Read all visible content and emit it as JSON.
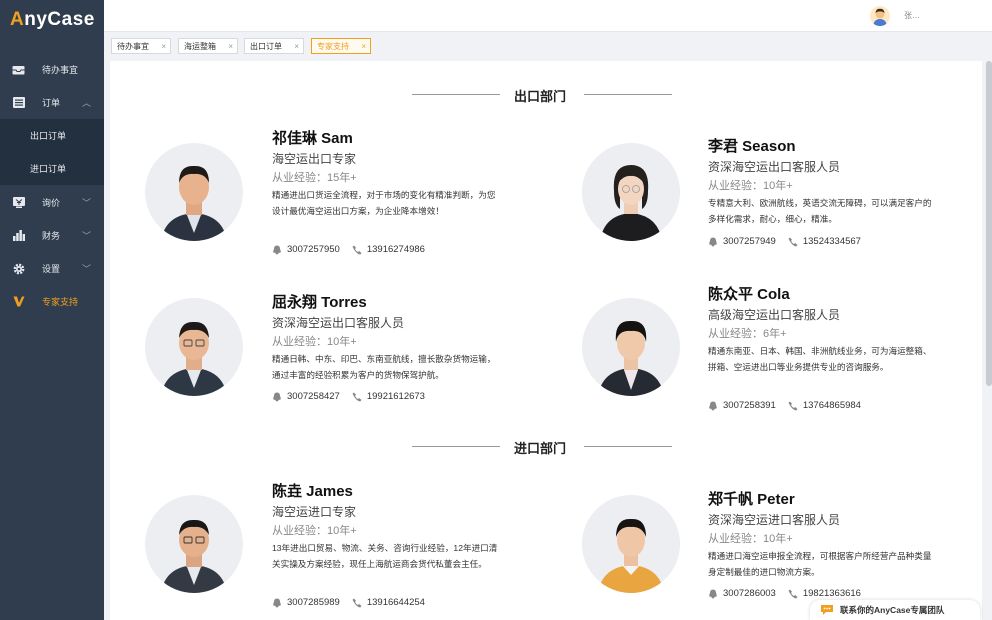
{
  "app": {
    "logo_a": "A",
    "logo_rest": "nyCase"
  },
  "sidebar": {
    "items": [
      {
        "label": "待办事宜",
        "icon": "inbox-icon"
      },
      {
        "label": "订单",
        "icon": "list-icon"
      },
      {
        "label": "出口订单"
      },
      {
        "label": "进口订单"
      },
      {
        "label": "询价",
        "icon": "quote-icon"
      },
      {
        "label": "财务",
        "icon": "chart-icon"
      },
      {
        "label": "设置",
        "icon": "gear-icon"
      },
      {
        "label": "专家支持",
        "icon": "v-icon"
      }
    ],
    "accent": "#f0a020"
  },
  "header": {
    "user_name": "张…"
  },
  "tabs": [
    {
      "label": "待办事宜"
    },
    {
      "label": "海运整箱"
    },
    {
      "label": "出口订单"
    },
    {
      "label": "专家支持"
    }
  ],
  "sections": {
    "export": "出口部门",
    "import": "进口部门"
  },
  "experts": [
    {
      "name": "祁佳琳 Sam",
      "role": "海空运出口专家",
      "exp": "从业经验：15年+",
      "desc": "精通进出口货运全流程，对于市场的变化有精准判断，为您设计最优海空运出口方案，为企业降本增效！",
      "qq": "3007257950",
      "phone": "13916274986"
    },
    {
      "name": "李君 Season",
      "role": "资深海空运出口客服人员",
      "exp": "从业经验：10年+",
      "desc": "专精意大利、欧洲航线，英语交流无障碍，可以满足客户的多样化需求，耐心，细心，精准。",
      "qq": "3007257949",
      "phone": "13524334567"
    },
    {
      "name": "屈永翔 Torres",
      "role": "资深海空运出口客服人员",
      "exp": "从业经验：10年+",
      "desc": "精通日韩、中东、印巴、东南亚航线，擅长散杂货物运输，通过丰富的经验积累为客户的货物保驾护航。",
      "qq": "3007258427",
      "phone": "19921612673"
    },
    {
      "name": "陈众平 Cola",
      "role": "高级海空运出口客服人员",
      "exp": "从业经验：6年+",
      "desc": "精通东南亚、日本、韩国、非洲航线业务，可为海运整箱、拼箱、空运进出口等业务提供专业的咨询服务。",
      "qq": "3007258391",
      "phone": "13764865984"
    },
    {
      "name": "陈垚 James",
      "role": "海空运进口专家",
      "exp": "从业经验：10年+",
      "desc": "13年进出口贸易、物流、关务、咨询行业经验，12年进口清关实操及方案经验，现任上海航运商会货代私董会主任。",
      "qq": "3007285989",
      "phone": "13916644254"
    },
    {
      "name": "郑千帆 Peter",
      "role": "资深海空运进口客服人员",
      "exp": "从业经验：10年+",
      "desc": "精通进口海空运申报全流程，可根据客户所经营产品种类量身定制最佳的进口物流方案。",
      "qq": "3007286003",
      "phone": "19821363616"
    }
  ],
  "chat": {
    "label": "联系你的AnyCase专属团队"
  }
}
